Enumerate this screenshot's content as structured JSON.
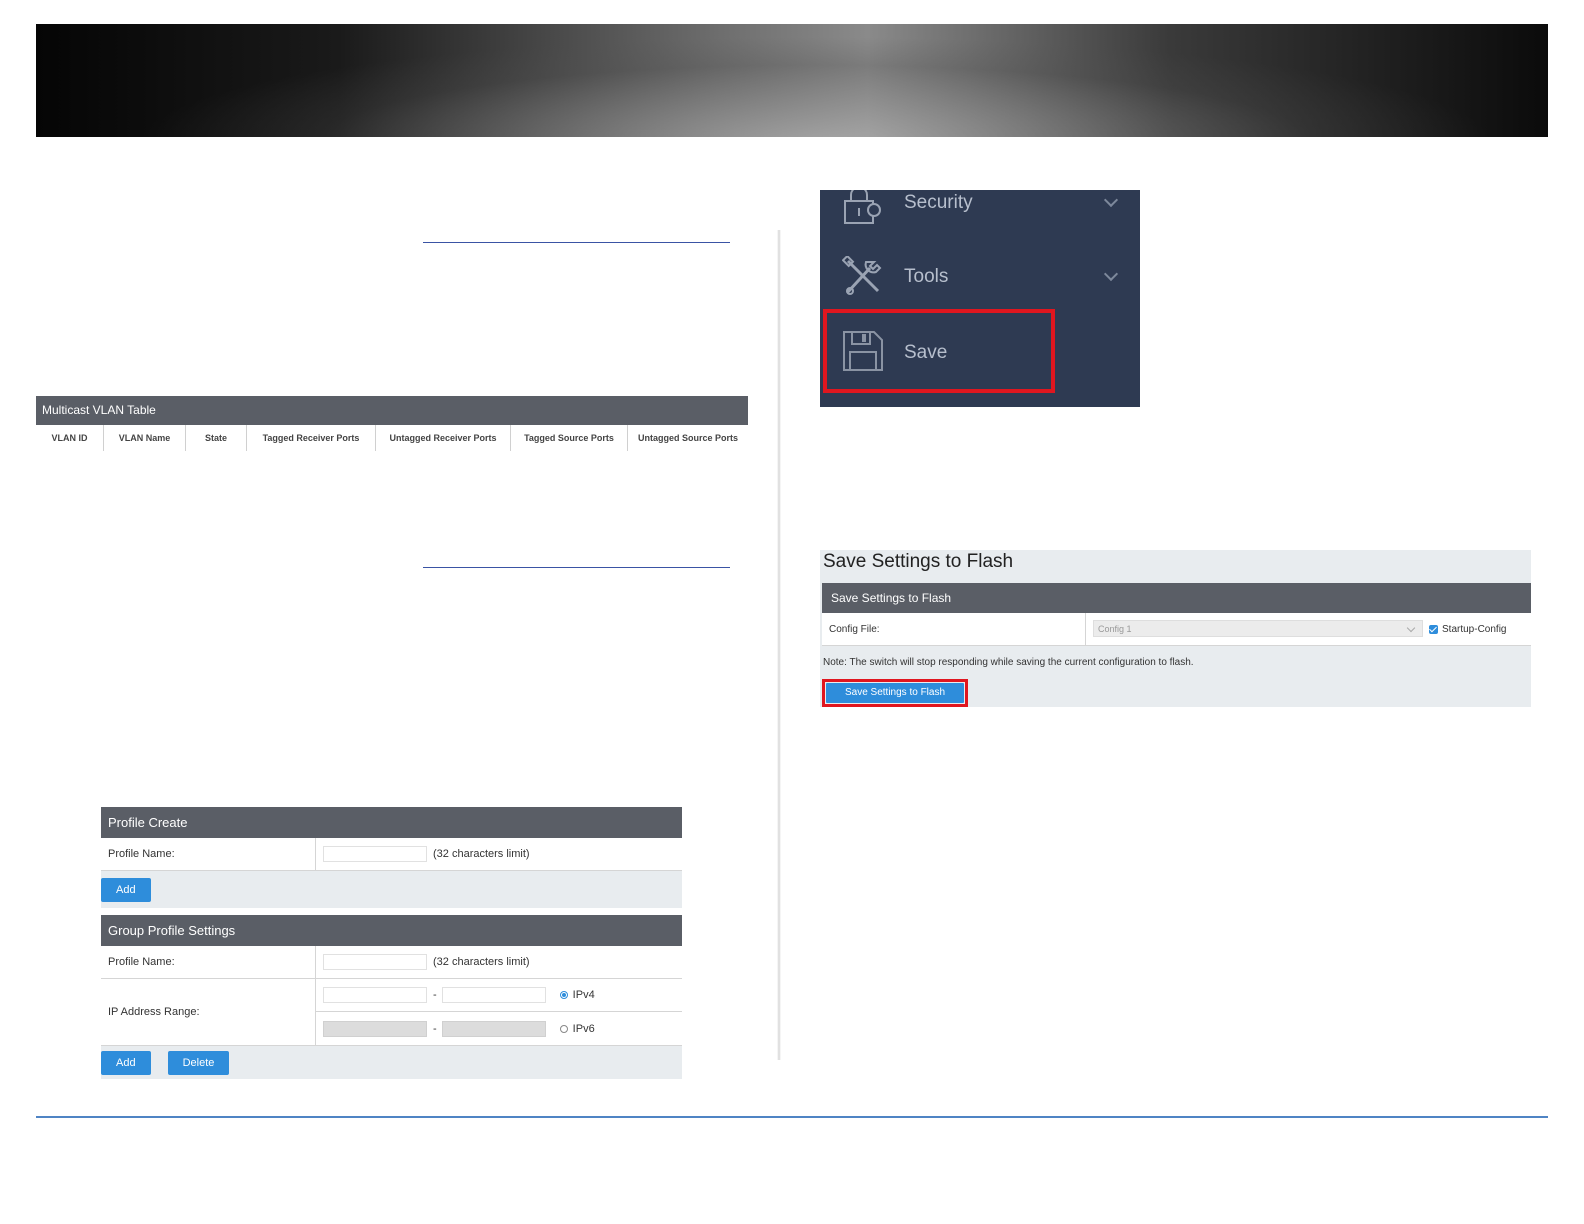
{
  "multicast_vlan_table": {
    "title": "Multicast VLAN Table",
    "columns": [
      "VLAN ID",
      "VLAN Name",
      "State",
      "Tagged Receiver Ports",
      "Untagged Receiver Ports",
      "Tagged Source Ports",
      "Untagged Source Ports"
    ]
  },
  "profile_create": {
    "title": "Profile Create",
    "profile_name_label": "Profile Name:",
    "limit_text": "(32 characters limit)",
    "add_label": "Add"
  },
  "group_profile": {
    "title": "Group Profile Settings",
    "profile_name_label": "Profile Name:",
    "limit_text": "(32 characters limit)",
    "ip_range_label": "IP Address Range:",
    "dash": "-",
    "ipv4_label": "IPv4",
    "ipv6_label": "IPv6",
    "selected": "IPv4",
    "add_label": "Add",
    "delete_label": "Delete"
  },
  "menu": {
    "items": [
      {
        "label": "Security",
        "icon": "lock-icon"
      },
      {
        "label": "Tools",
        "icon": "tools-icon"
      },
      {
        "label": "Save",
        "icon": "floppy-disk-icon"
      }
    ]
  },
  "save_flash": {
    "page_title": "Save Settings to Flash",
    "panel_title": "Save Settings to Flash",
    "config_file_label": "Config File:",
    "config_file_value": "Config 1",
    "startup_config_label": "Startup-Config",
    "startup_config_checked": true,
    "note": "Note: The switch will stop responding while saving the current configuration to flash.",
    "button_label": "Save Settings to Flash"
  },
  "colors": {
    "accent_blue": "#2e8ddb",
    "header_gray": "#5a5e66",
    "menu_bg": "#2e3a52",
    "highlight_red": "#e0161f"
  }
}
